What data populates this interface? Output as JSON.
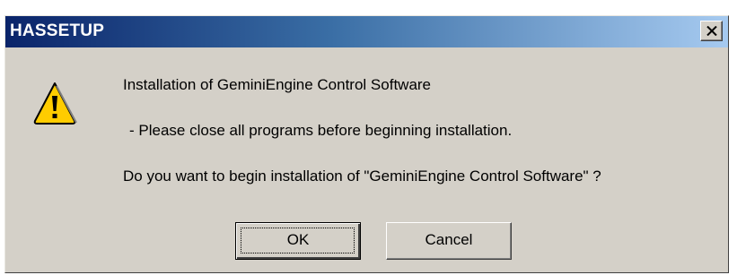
{
  "window": {
    "title": "HASSETUP",
    "close_icon": "close-icon"
  },
  "icon": {
    "name": "warning-icon",
    "color": "#ffcc00"
  },
  "message": {
    "line1": "Installation of GeminiEngine Control Software",
    "line2": "- Please close all programs before beginning installation.",
    "line3": "Do you want to begin installation of \"GeminiEngine Control Software\" ?"
  },
  "buttons": {
    "ok": "OK",
    "cancel": "Cancel"
  },
  "colors": {
    "titlebar_start": "#0a246a",
    "titlebar_end": "#a6caf0",
    "dialog_background": "#d4d0c8"
  }
}
